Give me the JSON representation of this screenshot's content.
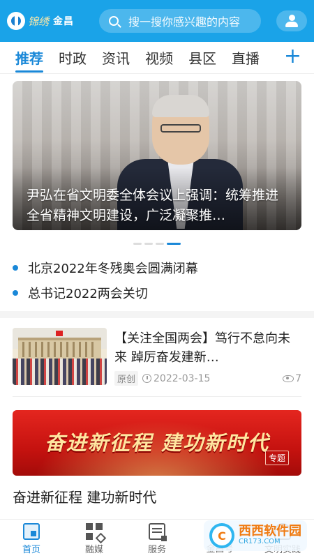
{
  "header": {
    "logo_cn": "锦绣",
    "logo_text": "金昌",
    "search_placeholder": "搜一搜你感兴趣的内容"
  },
  "tabs": [
    {
      "label": "推荐",
      "active": true
    },
    {
      "label": "时政"
    },
    {
      "label": "资讯"
    },
    {
      "label": "视频"
    },
    {
      "label": "县区"
    },
    {
      "label": "直播"
    }
  ],
  "carousel": {
    "caption": "尹弘在省文明委全体会议上强调：统筹推进全省精神文明建设，广泛凝聚推…",
    "slide_count": 4,
    "active_index": 3
  },
  "headlines": [
    "北京2022年冬残奥会圆满闭幕",
    "总书记2022两会关切"
  ],
  "news": {
    "title": "【关注全国两会】笃行不怠向未来 踔厉奋发建新…",
    "tag": "原创",
    "date": "2022-03-15",
    "views": "7"
  },
  "banner": {
    "text": "奋进新征程 建功新时代",
    "tag": "专题",
    "title": "奋进新征程 建功新时代"
  },
  "bottom_nav": [
    {
      "label": "首页",
      "icon": "home-icon",
      "active": true
    },
    {
      "label": "融媒",
      "icon": "media-icon"
    },
    {
      "label": "服务",
      "icon": "service-icon"
    },
    {
      "label": "金昌号",
      "icon": "jcn-icon"
    },
    {
      "label": "文明实践",
      "icon": "civil-icon"
    }
  ],
  "watermark": {
    "text": "西西软件园",
    "sub": "CR173.COM"
  },
  "colors": {
    "primary": "#1aa3e8",
    "accent": "#1a88d8",
    "banner_red": "#d41a15"
  }
}
